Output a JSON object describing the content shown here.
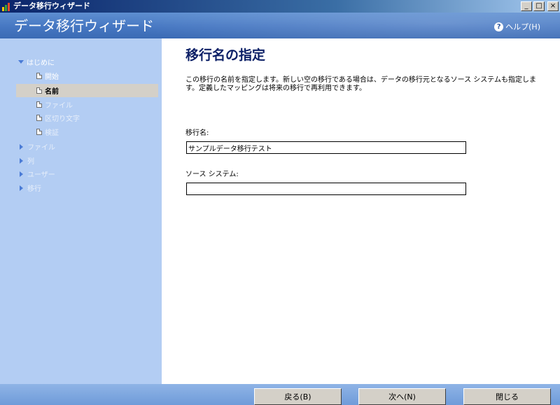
{
  "window": {
    "title": "データ移行ウィザード",
    "buttons": {
      "minimize": "_",
      "maximize": "□",
      "close": "×"
    }
  },
  "header": {
    "wizard_title": "データ移行ウィザード",
    "help_label": "ヘルプ(H)",
    "help_glyph": "?"
  },
  "sidebar": {
    "items": [
      {
        "label": "はじめに",
        "kind": "group-open",
        "state": "normal"
      },
      {
        "label": "開始",
        "kind": "page",
        "state": "normal"
      },
      {
        "label": "名前",
        "kind": "page",
        "state": "current"
      },
      {
        "label": "ファイル",
        "kind": "page",
        "state": "disabled"
      },
      {
        "label": "区切り文字",
        "kind": "page",
        "state": "disabled"
      },
      {
        "label": "検証",
        "kind": "page",
        "state": "disabled"
      },
      {
        "label": "ファイル",
        "kind": "group-closed",
        "state": "disabled"
      },
      {
        "label": "列",
        "kind": "group-closed",
        "state": "disabled"
      },
      {
        "label": "ユーザー",
        "kind": "group-closed",
        "state": "disabled"
      },
      {
        "label": "移行",
        "kind": "group-closed",
        "state": "disabled"
      }
    ]
  },
  "main": {
    "title": "移行名の指定",
    "description": "この移行の名前を指定します。新しい空の移行である場合は、データの移行元となるソース システムも指定します。定義したマッピングは将来の移行で再利用できます。",
    "fields": {
      "migration_name": {
        "label": "移行名:",
        "value": "サンプルデータ移行テスト"
      },
      "source_system": {
        "label": "ソース システム:",
        "value": ""
      }
    }
  },
  "footer": {
    "back_label": "戻る(B)",
    "next_label": "次へ(N)",
    "close_label": "閉じる"
  },
  "colors": {
    "title_text": "#0b1f66",
    "sidebar_bg": "#b3cdf3",
    "header_bg": "#4677c2"
  }
}
